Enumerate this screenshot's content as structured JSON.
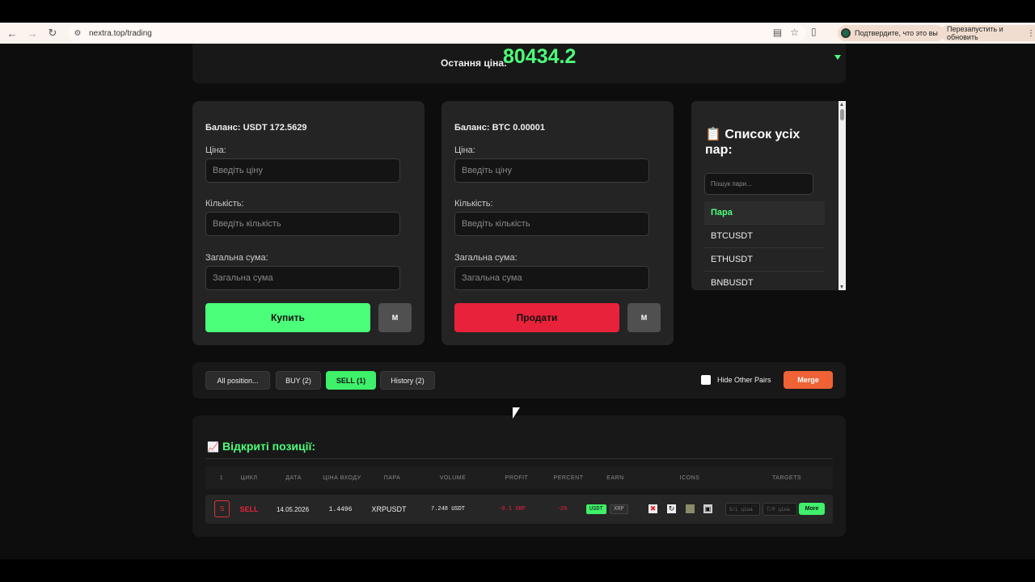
{
  "browser": {
    "url": "nextra.top/trading",
    "profile_prompt": "Подтвердите, что это вы",
    "update_prompt": "Перезапустить и обновить"
  },
  "ticker": {
    "label": "Остання ціна:",
    "value": "80434.2"
  },
  "buy_form": {
    "balance": "Баланс: USDT 172.5629",
    "price_label": "Ціна:",
    "price_placeholder": "Введіть ціну",
    "qty_label": "Кількість:",
    "qty_placeholder": "Введіть кількість",
    "total_label": "Загальна сума:",
    "total_placeholder": "Загальна сума",
    "submit_label": "Купить",
    "m_label": "M"
  },
  "sell_form": {
    "balance": "Баланс: BTC 0.00001",
    "price_label": "Ціна:",
    "price_placeholder": "Введіть ціну",
    "qty_label": "Кількість:",
    "qty_placeholder": "Введіть кількість",
    "total_label": "Загальна сума:",
    "total_placeholder": "Загальна сума",
    "submit_label": "Продати",
    "m_label": "M"
  },
  "pairs": {
    "icon": "📋",
    "title": "Список усіх пар:",
    "search_placeholder": "Пошук пари...",
    "header": "Пара",
    "items": [
      "BTCUSDT",
      "ETHUSDT",
      "BNBUSDT"
    ]
  },
  "filters": {
    "all": "All position...",
    "buy": "BUY (2)",
    "sell": "SELL (1)",
    "history": "History (2)",
    "hide_other": "Hide Other Pairs",
    "merge": "Merge"
  },
  "positions": {
    "icon": "📈",
    "title": "Відкриті позиції:",
    "columns": [
      "1",
      "ЦИКЛ",
      "ДАТА",
      "ЦІНА ВХОДУ",
      "ПАРА",
      "VOLUME",
      "PROFIT",
      "PERCENT",
      "EARN",
      "ICONS",
      "TARGETS"
    ],
    "rows": [
      {
        "badge": "S",
        "side": "SELL",
        "date": "14.05.2026",
        "entry": "1.4496",
        "pair": "XRPUSDT",
        "volume": "7.248 USDT",
        "profit": "-0.1 XRP",
        "percent": "-2%",
        "earn_usdt": "USDT",
        "earn_xrp": "XRP",
        "sl_placeholder": "S/L ціна",
        "tp_placeholder": "T/P ціна",
        "more": "More"
      }
    ]
  },
  "colors": {
    "accent_green": "#4cff7a",
    "sell_red": "#e8223a",
    "merge_orange": "#ee6236"
  }
}
